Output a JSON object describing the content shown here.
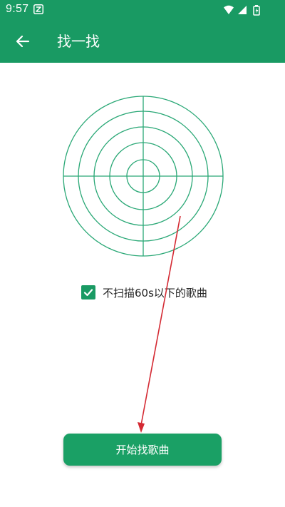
{
  "status_bar": {
    "time": "9:57",
    "app_icon": "z-app-icon",
    "icons": [
      "wifi-icon",
      "signal-icon",
      "battery-icon"
    ]
  },
  "header": {
    "title": "找一找",
    "back_icon": "arrow-left-icon"
  },
  "scan": {
    "radar_icon": "radar-icon",
    "skip_short_songs": {
      "label": "不扫描60s以下的歌曲",
      "checked": true
    }
  },
  "actions": {
    "start_label": "开始找歌曲"
  },
  "colors": {
    "primary": "#199a63",
    "radar_stroke": "#2aa876",
    "button": "#1aa065",
    "annotation": "#d42a33"
  }
}
